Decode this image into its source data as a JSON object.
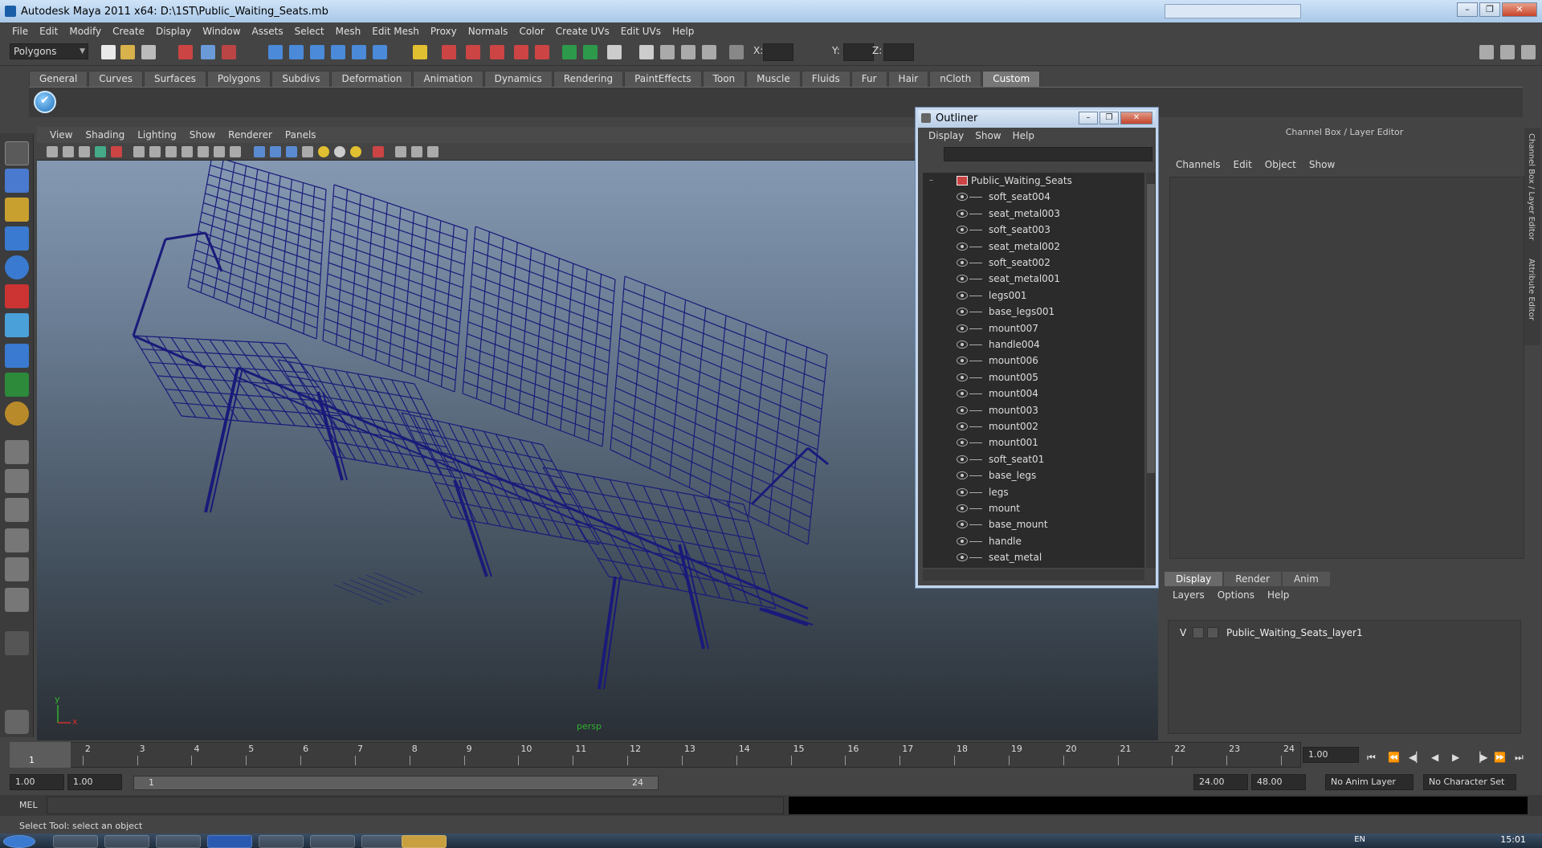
{
  "window": {
    "title": "Autodesk Maya 2011 x64: D:\\1ST\\Public_Waiting_Seats.mb",
    "min": "–",
    "max": "❐",
    "close": "✕"
  },
  "menubar": [
    "File",
    "Edit",
    "Modify",
    "Create",
    "Display",
    "Window",
    "Assets",
    "Select",
    "Mesh",
    "Edit Mesh",
    "Proxy",
    "Normals",
    "Color",
    "Create UVs",
    "Edit UVs",
    "Help"
  ],
  "mode_selector": {
    "value": "Polygons"
  },
  "coords": {
    "x": "X:",
    "y": "Y:",
    "z": "Z:"
  },
  "shelf_tabs": [
    {
      "label": "General"
    },
    {
      "label": "Curves"
    },
    {
      "label": "Surfaces"
    },
    {
      "label": "Polygons"
    },
    {
      "label": "Subdivs"
    },
    {
      "label": "Deformation"
    },
    {
      "label": "Animation"
    },
    {
      "label": "Dynamics"
    },
    {
      "label": "Rendering"
    },
    {
      "label": "PaintEffects"
    },
    {
      "label": "Toon"
    },
    {
      "label": "Muscle"
    },
    {
      "label": "Fluids"
    },
    {
      "label": "Fur"
    },
    {
      "label": "Hair"
    },
    {
      "label": "nCloth"
    },
    {
      "label": "Custom",
      "active": true
    }
  ],
  "viewport": {
    "menu": [
      "View",
      "Shading",
      "Lighting",
      "Show",
      "Renderer",
      "Panels"
    ],
    "camera_label": "persp",
    "axis": {
      "x": "x",
      "y": "y"
    },
    "wire_color": "#1a1a7a"
  },
  "outliner": {
    "title": "Outliner",
    "menu": [
      "Display",
      "Show",
      "Help"
    ],
    "collapse": "–",
    "root": "Public_Waiting_Seats",
    "items": [
      "soft_seat004",
      "seat_metal003",
      "soft_seat003",
      "seat_metal002",
      "soft_seat002",
      "seat_metal001",
      "legs001",
      "base_legs001",
      "mount007",
      "handle004",
      "mount006",
      "mount005",
      "mount004",
      "mount003",
      "mount002",
      "mount001",
      "soft_seat01",
      "base_legs",
      "legs",
      "mount",
      "base_mount",
      "handle",
      "seat_metal"
    ]
  },
  "channel_box": {
    "title": "Channel Box / Layer Editor",
    "menu": [
      "Channels",
      "Edit",
      "Object",
      "Show"
    ],
    "side_tabs": [
      "Channel Box / Layer Editor",
      "Attribute Editor"
    ]
  },
  "layer_editor": {
    "tabs": [
      {
        "label": "Display",
        "active": true
      },
      {
        "label": "Render"
      },
      {
        "label": "Anim"
      }
    ],
    "menu": [
      "Layers",
      "Options",
      "Help"
    ],
    "layer": {
      "visible": "V",
      "name": "Public_Waiting_Seats_layer1"
    }
  },
  "timeline": {
    "ticks": [
      "1",
      "2",
      "3",
      "4",
      "5",
      "6",
      "7",
      "8",
      "9",
      "10",
      "11",
      "12",
      "13",
      "14",
      "15",
      "16",
      "17",
      "18",
      "19",
      "20",
      "21",
      "22",
      "23",
      "24"
    ],
    "current_frame": "1",
    "current_time_field": "1.00",
    "start_time": "1.00",
    "playback_start": "1.00",
    "range_start": "1",
    "range_end": "24",
    "playback_end": "24.00",
    "end_time": "48.00",
    "anim_layer": "No Anim Layer",
    "char_set": "No Character Set"
  },
  "command_line": {
    "label": "MEL"
  },
  "help_line": "Select Tool: select an object",
  "taskbar": {
    "language": "EN",
    "clock": "15:01"
  }
}
